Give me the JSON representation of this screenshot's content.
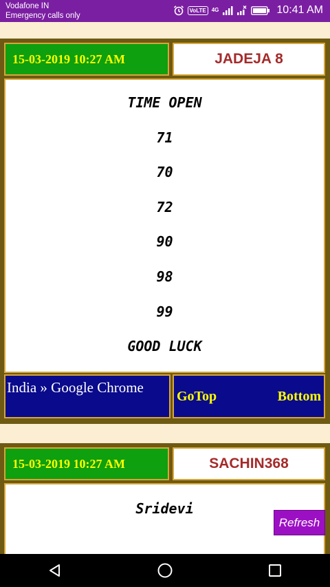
{
  "statusbar": {
    "carrier": "Vodafone IN",
    "subtext": "Emergency calls only",
    "volte": "VoLTE",
    "network": "4G",
    "time": "10:41 AM"
  },
  "posts": [
    {
      "date": "15-03-2019 10:27 AM",
      "author": "JADEJA 8",
      "lines": [
        "TIME OPEN",
        "71",
        "70",
        "72",
        "90",
        "98",
        "99",
        "GOOD LUCK"
      ],
      "footer": {
        "browser_text": "India  » Google Chrome",
        "gotop_label": "GoTop",
        "bottom_label": "Bottom"
      }
    },
    {
      "date": "15-03-2019 10:27 AM",
      "author": "SACHIN368",
      "lines": [
        "Sridevi"
      ]
    }
  ],
  "refresh_label": "Refresh",
  "colors": {
    "statusbar": "#7b1fa2",
    "date_bg": "#0ea00e",
    "date_text": "#ffff00",
    "author_text": "#a52a2a",
    "footer_bg": "#0a0a8c",
    "refresh_bg": "#9c10c4"
  }
}
